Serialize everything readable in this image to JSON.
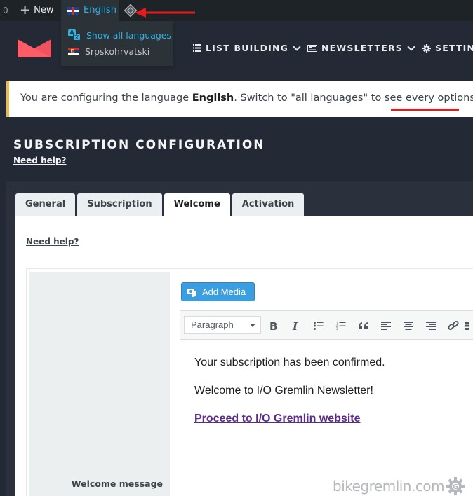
{
  "admin_bar": {
    "count": "0",
    "new_label": "New",
    "language_label": "English",
    "language_menu": [
      {
        "label": "Show all languages",
        "icon": "translate-icon"
      },
      {
        "label": "Srpskohrvatski",
        "icon": "serbian-flag-icon"
      }
    ],
    "plugin_icon": "diamond-icon"
  },
  "nav": {
    "items": [
      {
        "label": "LIST BUILDING",
        "icon": "list-icon"
      },
      {
        "label": "NEWSLETTERS",
        "icon": "newspaper-icon"
      },
      {
        "label": "SETTINGS",
        "icon": "gear-icon"
      }
    ]
  },
  "notice": {
    "prefix": "You are configuring the language ",
    "language": "English",
    "suffix": ". Switch to \"all languages\" to see every options."
  },
  "page": {
    "title": "SUBSCRIPTION CONFIGURATION",
    "help_link": "Need help?"
  },
  "tabs": [
    {
      "label": "General",
      "active": false
    },
    {
      "label": "Subscription",
      "active": false
    },
    {
      "label": "Welcome",
      "active": true
    },
    {
      "label": "Activation",
      "active": false
    }
  ],
  "content": {
    "help_link": "Need help?",
    "field_label": "Welcome message",
    "add_media_label": "Add Media",
    "format_select_value": "Paragraph",
    "toolbar_icons": [
      "bold-icon",
      "italic-icon",
      "bullet-list-icon",
      "numbered-list-icon",
      "blockquote-icon",
      "align-left-icon",
      "align-center-icon",
      "align-right-icon",
      "link-icon",
      "more-icon"
    ],
    "editor_paragraphs": [
      "Your subscription has been confirmed.",
      "Welcome to I/O Gremlin Newsletter!"
    ],
    "editor_link": "Proceed to I/O Gremlin website"
  },
  "colors": {
    "accent_blue": "#2fb2e5",
    "notice_border": "#f0b849",
    "annotation_red": "#e51b1b",
    "brand_logo": "#fe5c67",
    "link_purple": "#5b2a8b"
  },
  "watermark": "bikegremlin.com"
}
